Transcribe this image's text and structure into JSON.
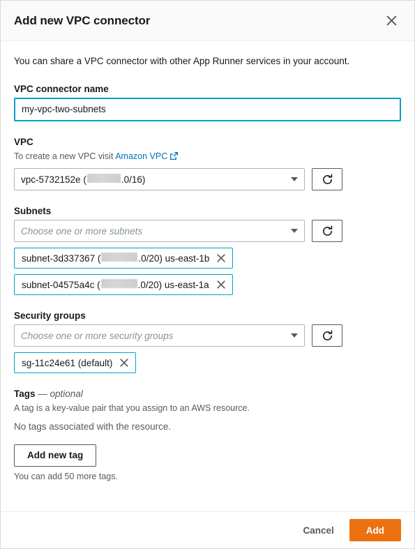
{
  "modal": {
    "title": "Add new VPC connector",
    "close_icon": "close-icon",
    "intro": "You can share a VPC connector with other App Runner services in your account."
  },
  "connector_name": {
    "label": "VPC connector name",
    "value": "my-vpc-two-subnets",
    "placeholder": ""
  },
  "vpc": {
    "label": "VPC",
    "description_prefix": "To create a new VPC visit ",
    "link_text": "Amazon VPC",
    "link_icon": "external-link-icon",
    "selected_prefix": "vpc-5732152e (",
    "selected_suffix": ".0/16)",
    "caret_icon": "chevron-down-icon",
    "refresh_icon": "refresh-icon"
  },
  "subnets": {
    "label": "Subnets",
    "placeholder": "Choose one or more subnets",
    "caret_icon": "chevron-down-icon",
    "refresh_icon": "refresh-icon",
    "selected": [
      {
        "prefix": "subnet-3d337367 (",
        "suffix": ".0/20) us-east-1b",
        "remove_icon": "close-icon"
      },
      {
        "prefix": "subnet-04575a4c (",
        "suffix": ".0/20) us-east-1a",
        "remove_icon": "close-icon"
      }
    ]
  },
  "security_groups": {
    "label": "Security groups",
    "placeholder": "Choose one or more security groups",
    "caret_icon": "chevron-down-icon",
    "refresh_icon": "refresh-icon",
    "selected": [
      {
        "label": "sg-11c24e61 (default)",
        "remove_icon": "close-icon"
      }
    ]
  },
  "tags": {
    "label": "Tags",
    "optional_suffix": " — optional",
    "description": "A tag is a key-value pair that you assign to an AWS resource.",
    "empty_state": "No tags associated with the resource.",
    "add_button": "Add new tag",
    "hint": "You can add 50 more tags."
  },
  "footer": {
    "cancel_label": "Cancel",
    "add_label": "Add"
  },
  "colors": {
    "accent_orange": "#ec7211",
    "focus_teal": "#00a1c9",
    "link_blue": "#0073bb",
    "text_primary": "#16191f",
    "text_secondary": "#545b64",
    "header_bg": "#fafafa",
    "border": "#aab7b8"
  }
}
